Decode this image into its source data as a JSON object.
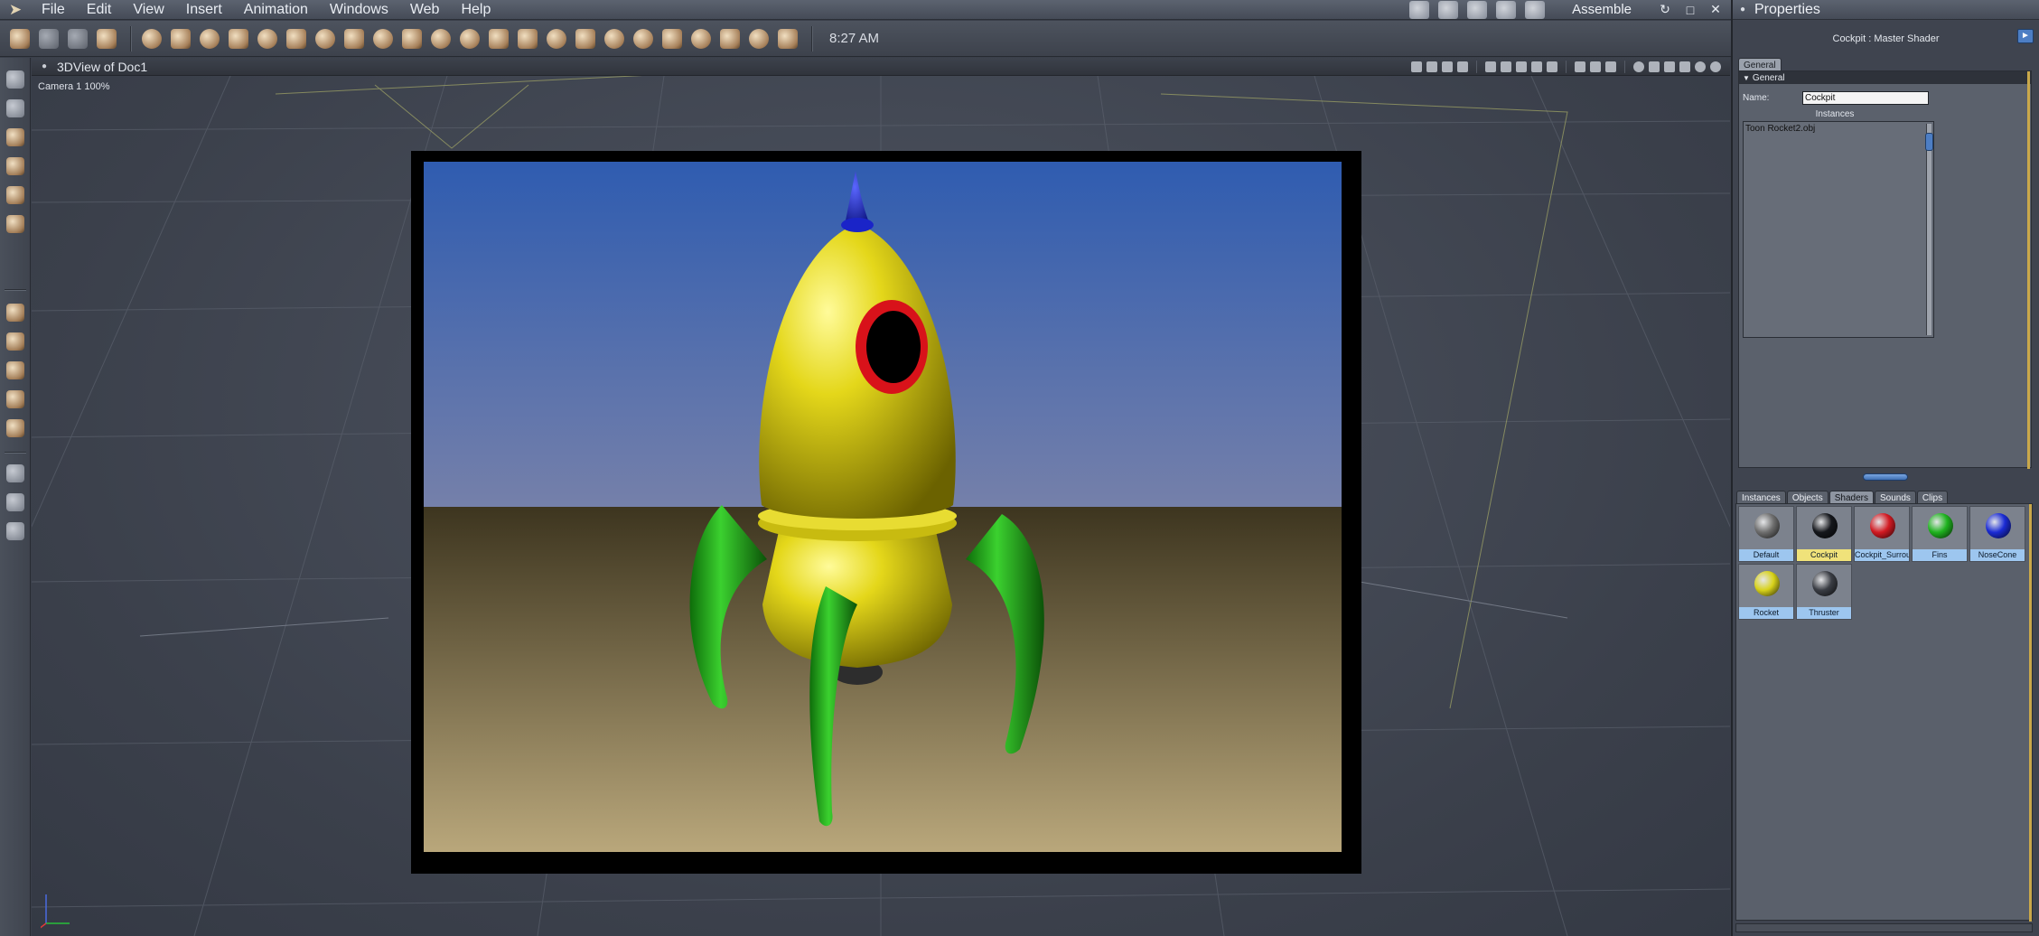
{
  "menubar": {
    "items": [
      "File",
      "Edit",
      "View",
      "Insert",
      "Animation",
      "Windows",
      "Web",
      "Help"
    ],
    "room_label": "Assemble",
    "window_buttons": [
      "↻",
      "□",
      "✕"
    ]
  },
  "toolbar": {
    "clock": "8:27 AM"
  },
  "viewport": {
    "title": "3DView of Doc1",
    "camera_label": "Camera 1 100%",
    "close_glyph": "●"
  },
  "properties": {
    "title": "Properties",
    "close_glyph": "●",
    "shader_title": "Cockpit : Master Shader",
    "menu_glyph": "►",
    "tab": "General",
    "section": "General",
    "name_label": "Name:",
    "name_value": "Cockpit",
    "instances_label": "Instances",
    "instance_item": "Toon Rocket2.obj"
  },
  "library": {
    "tabs": [
      "Instances",
      "Objects",
      "Shaders",
      "Sounds",
      "Clips"
    ],
    "active_tab": "Shaders",
    "shaders": [
      {
        "name": "Default",
        "color": "#6e6e6e"
      },
      {
        "name": "Cockpit",
        "color": "#15171c",
        "selected": true
      },
      {
        "name": "Cockpit_Surrou",
        "color": "#d21a22"
      },
      {
        "name": "Fins",
        "color": "#1fb31f"
      },
      {
        "name": "NoseCone",
        "color": "#1a2bd4"
      },
      {
        "name": "Rocket",
        "color": "#d8d21a"
      },
      {
        "name": "Thruster",
        "color": "#3a3d44"
      }
    ]
  },
  "colors": {
    "sky_top": "#2f5cb0",
    "sky_bottom": "#7580aa",
    "ground_top": "#3d351f",
    "ground_bottom": "#b9a77b",
    "rocket_body": "#e4d71a",
    "fins": "#21c21a",
    "nose_tip": "#1a24c8",
    "window_ring": "#d8121a",
    "accent_selection": "#f0e27a"
  }
}
